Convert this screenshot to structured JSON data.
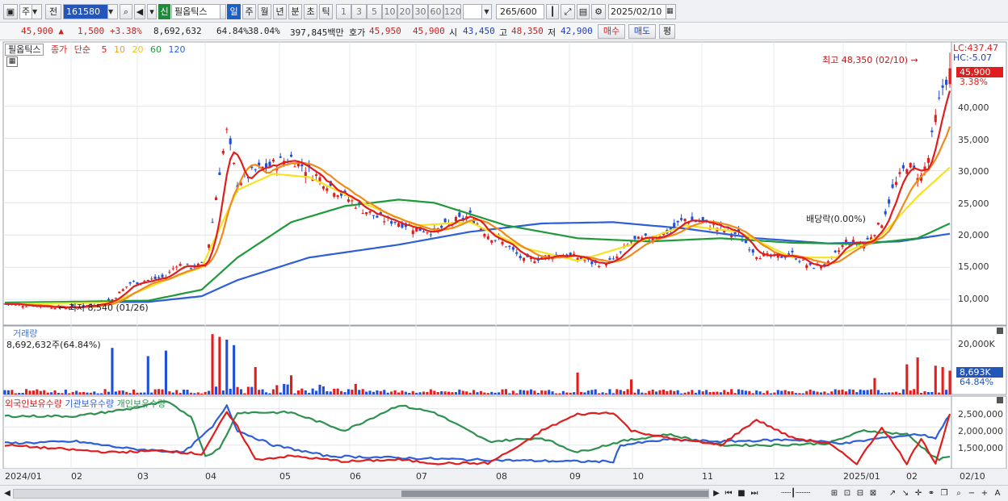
{
  "toolbar": {
    "market": "주",
    "prev": "전",
    "code": "161580",
    "stock_name": "필옵틱스",
    "badge": "신",
    "periods": [
      "일",
      "주",
      "월",
      "년",
      "분",
      "초",
      "틱"
    ],
    "active_period": "일",
    "intervals": [
      "1",
      "3",
      "5",
      "10",
      "20",
      "30",
      "60",
      "120"
    ],
    "count": "265",
    "count_total": "/600",
    "date": "2025/02/10"
  },
  "quote": {
    "price": "45,900",
    "change": "1,500",
    "change_pct": "+3.38%",
    "volume": "8,692,632",
    "vol_ratio": "64.84%",
    "turnover": "38.04%",
    "amount": "397,845백만",
    "ask_label": "호가",
    "ask": "45,950",
    "bid": "45,900",
    "open_label": "시",
    "open": "43,450",
    "high_label": "고",
    "high": "48,350",
    "low_label": "저",
    "low": "42,900",
    "buy_label": "매수",
    "sell_label": "매도",
    "avg_label": "평"
  },
  "legend": {
    "stock": "필옵틱스",
    "close": "종가",
    "simple": "단순",
    "ma": [
      "5",
      "10",
      "20",
      "60",
      "120"
    ]
  },
  "colors": {
    "up": "#e01e1e",
    "down": "#1f4ed8",
    "ma5": "#e01e1e",
    "ma10": "#f08a1d",
    "ma20": "#f5e321",
    "ma60": "#1f9a3a",
    "ma120": "#2f5fd6",
    "foreign": "#e01e1e",
    "institution": "#2f5fd6",
    "individual": "#2e9150"
  },
  "price_panel": {
    "lc": "LC:437.47",
    "hc": "HC:-5.07",
    "current_badge": "45,900",
    "current_pct": "3.38%",
    "high_annotation": "최고 48,350 (02/10)",
    "low_annotation": "최저 8,540 (01/26)",
    "event_annotation": "배당락(0.00%)",
    "y_ticks": [
      "40,000",
      "35,000",
      "30,000",
      "25,000",
      "20,000",
      "15,000",
      "10,000"
    ]
  },
  "volume_panel": {
    "title": "거래량",
    "value": "8,692,632주(64.84%)",
    "y_tick": "20,000K",
    "current_badge": "8,693K",
    "current_pct": "64.84%"
  },
  "holding_panel": {
    "series": [
      "외국인보유수량",
      "기관보유수량",
      "개인보유수량"
    ],
    "y_ticks": [
      "2,500,000",
      "2,000,000",
      "1,500,000"
    ]
  },
  "x_axis": {
    "labels": [
      "2024/01",
      "02",
      "03",
      "04",
      "05",
      "06",
      "07",
      "08",
      "09",
      "10",
      "11",
      "12",
      "2025/01",
      "02"
    ],
    "last": "02/10"
  },
  "chart_data": {
    "type": "candlestick",
    "ylim": [
      6000,
      50000
    ],
    "anchors": [
      [
        0,
        9300
      ],
      [
        10,
        9000
      ],
      [
        18,
        8700
      ],
      [
        25,
        9200
      ],
      [
        30,
        10000
      ],
      [
        35,
        12500
      ],
      [
        40,
        13000
      ],
      [
        45,
        13500
      ],
      [
        48,
        15500
      ],
      [
        52,
        15000
      ],
      [
        56,
        15500
      ],
      [
        58,
        22000
      ],
      [
        60,
        30000
      ],
      [
        62,
        36000
      ],
      [
        65,
        28000
      ],
      [
        70,
        30000
      ],
      [
        75,
        31000
      ],
      [
        80,
        32000
      ],
      [
        85,
        30000
      ],
      [
        90,
        28000
      ],
      [
        95,
        26000
      ],
      [
        100,
        24000
      ],
      [
        105,
        22500
      ],
      [
        110,
        22000
      ],
      [
        115,
        21000
      ],
      [
        120,
        20500
      ],
      [
        125,
        22000
      ],
      [
        130,
        23000
      ],
      [
        135,
        20000
      ],
      [
        140,
        18500
      ],
      [
        145,
        16000
      ],
      [
        150,
        16500
      ],
      [
        155,
        17000
      ],
      [
        160,
        16500
      ],
      [
        165,
        15500
      ],
      [
        170,
        16000
      ],
      [
        175,
        19000
      ],
      [
        180,
        19500
      ],
      [
        185,
        20500
      ],
      [
        190,
        22500
      ],
      [
        195,
        22000
      ],
      [
        200,
        21000
      ],
      [
        205,
        20000
      ],
      [
        210,
        17000
      ],
      [
        215,
        16500
      ],
      [
        220,
        17000
      ],
      [
        225,
        15000
      ],
      [
        230,
        15500
      ],
      [
        235,
        19000
      ],
      [
        240,
        18500
      ],
      [
        245,
        22000
      ],
      [
        248,
        27000
      ],
      [
        252,
        31000
      ],
      [
        256,
        29000
      ],
      [
        258,
        32000
      ],
      [
        260,
        38000
      ],
      [
        262,
        43000
      ],
      [
        264,
        45900
      ]
    ],
    "ma_anchors": {
      "ma20": [
        [
          0,
          9300
        ],
        [
          30,
          9500
        ],
        [
          45,
          13000
        ],
        [
          55,
          15000
        ],
        [
          65,
          27000
        ],
        [
          75,
          29500
        ],
        [
          85,
          29000
        ],
        [
          100,
          25000
        ],
        [
          115,
          21500
        ],
        [
          130,
          22000
        ],
        [
          145,
          18000
        ],
        [
          160,
          16000
        ],
        [
          175,
          18500
        ],
        [
          190,
          21500
        ],
        [
          205,
          20500
        ],
        [
          220,
          16500
        ],
        [
          232,
          16500
        ],
        [
          245,
          20000
        ],
        [
          255,
          26000
        ],
        [
          264,
          30500
        ]
      ],
      "ma60": [
        [
          0,
          9500
        ],
        [
          40,
          9800
        ],
        [
          55,
          11500
        ],
        [
          65,
          16500
        ],
        [
          80,
          22000
        ],
        [
          95,
          24500
        ],
        [
          110,
          25500
        ],
        [
          120,
          25000
        ],
        [
          140,
          21500
        ],
        [
          160,
          19500
        ],
        [
          180,
          19000
        ],
        [
          200,
          19500
        ],
        [
          220,
          18800
        ],
        [
          240,
          18600
        ],
        [
          255,
          19500
        ],
        [
          264,
          21800
        ]
      ],
      "ma120": [
        [
          0,
          9500
        ],
        [
          40,
          9600
        ],
        [
          55,
          10500
        ],
        [
          65,
          13000
        ],
        [
          85,
          16500
        ],
        [
          110,
          18500
        ],
        [
          130,
          20500
        ],
        [
          150,
          21800
        ],
        [
          170,
          22000
        ],
        [
          190,
          21000
        ],
        [
          210,
          19500
        ],
        [
          230,
          18700
        ],
        [
          250,
          19000
        ],
        [
          264,
          20200
        ]
      ]
    },
    "volume_spikes": [
      [
        30,
        17000
      ],
      [
        40,
        14000
      ],
      [
        45,
        16000
      ],
      [
        58,
        22000
      ],
      [
        60,
        21000
      ],
      [
        62,
        20000
      ],
      [
        64,
        18000
      ],
      [
        70,
        10000
      ],
      [
        80,
        7000
      ],
      [
        160,
        8000
      ],
      [
        175,
        5500
      ],
      [
        243,
        6000
      ],
      [
        252,
        11000
      ],
      [
        255,
        13500
      ],
      [
        260,
        10500
      ],
      [
        262,
        10000
      ],
      [
        264,
        8693
      ]
    ],
    "holding": {
      "foreign": [
        [
          0,
          1500000
        ],
        [
          15,
          1400000
        ],
        [
          30,
          1300000
        ],
        [
          45,
          1350000
        ],
        [
          55,
          1250000
        ],
        [
          62,
          2400000
        ],
        [
          65,
          2000000
        ],
        [
          70,
          1100000
        ],
        [
          80,
          1200000
        ],
        [
          95,
          1050000
        ],
        [
          110,
          1100000
        ],
        [
          120,
          1000000
        ],
        [
          135,
          1000000
        ],
        [
          145,
          1550000
        ],
        [
          150,
          1900000
        ],
        [
          160,
          2350000
        ],
        [
          170,
          2400000
        ],
        [
          175,
          1900000
        ],
        [
          185,
          1700000
        ],
        [
          200,
          1500000
        ],
        [
          210,
          2200000
        ],
        [
          220,
          1700000
        ],
        [
          230,
          1550000
        ],
        [
          238,
          1000000
        ],
        [
          245,
          2000000
        ],
        [
          252,
          1000000
        ],
        [
          256,
          1700000
        ],
        [
          260,
          1000000
        ],
        [
          264,
          2350000
        ]
      ],
      "institution": [
        [
          0,
          1550000
        ],
        [
          20,
          1600000
        ],
        [
          35,
          1400000
        ],
        [
          50,
          1300000
        ],
        [
          58,
          2000000
        ],
        [
          62,
          2600000
        ],
        [
          65,
          1900000
        ],
        [
          75,
          1500000
        ],
        [
          90,
          1200000
        ],
        [
          110,
          1150000
        ],
        [
          130,
          1100000
        ],
        [
          160,
          1050000
        ],
        [
          170,
          1050000
        ],
        [
          172,
          1500000
        ],
        [
          185,
          1650000
        ],
        [
          200,
          1600000
        ],
        [
          220,
          1650000
        ],
        [
          235,
          1550000
        ],
        [
          245,
          1700000
        ],
        [
          255,
          1800000
        ],
        [
          260,
          1700000
        ],
        [
          264,
          2350000
        ]
      ],
      "individual": [
        [
          0,
          2300000
        ],
        [
          20,
          2300000
        ],
        [
          35,
          2500000
        ],
        [
          45,
          2700000
        ],
        [
          52,
          2300000
        ],
        [
          56,
          1200000
        ],
        [
          60,
          1400000
        ],
        [
          65,
          2400000
        ],
        [
          80,
          2400000
        ],
        [
          95,
          1900000
        ],
        [
          110,
          2600000
        ],
        [
          120,
          2400000
        ],
        [
          135,
          1600000
        ],
        [
          150,
          1700000
        ],
        [
          160,
          1300000
        ],
        [
          172,
          1600000
        ],
        [
          185,
          1800000
        ],
        [
          200,
          1500000
        ],
        [
          215,
          1500000
        ],
        [
          230,
          1550000
        ],
        [
          240,
          1900000
        ],
        [
          252,
          1800000
        ],
        [
          258,
          1300000
        ],
        [
          261,
          1100000
        ],
        [
          264,
          1200000
        ]
      ]
    }
  }
}
